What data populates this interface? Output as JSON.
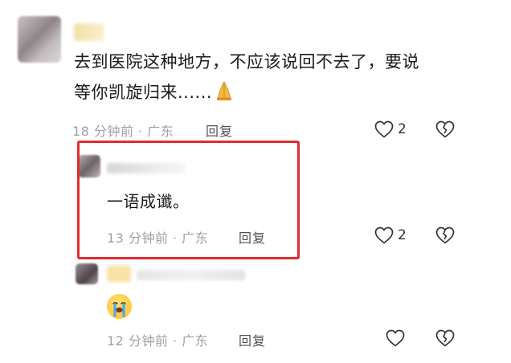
{
  "comments": [
    {
      "text_line1": "去到医院这种地方，不应该说回不去了，要说",
      "text_line2": "等你凯旋归来......",
      "emoji_name": "pray-hands-icon",
      "time": "18 分钟前",
      "sep": "·",
      "location": "广东",
      "reply_label": "回复",
      "likes": "2"
    },
    {
      "text": "一语成谶。",
      "time": "13 分钟前",
      "sep": "·",
      "location": "广东",
      "reply_label": "回复",
      "likes": "2"
    },
    {
      "emoji_name": "crying-face-icon",
      "time": "12 分钟前",
      "sep": "·",
      "location": "广东",
      "reply_label": "回复"
    }
  ],
  "colors": {
    "highlight_border": "#e12b2f",
    "meta_text": "#a0a0a0",
    "icon_stroke": "#333333"
  }
}
